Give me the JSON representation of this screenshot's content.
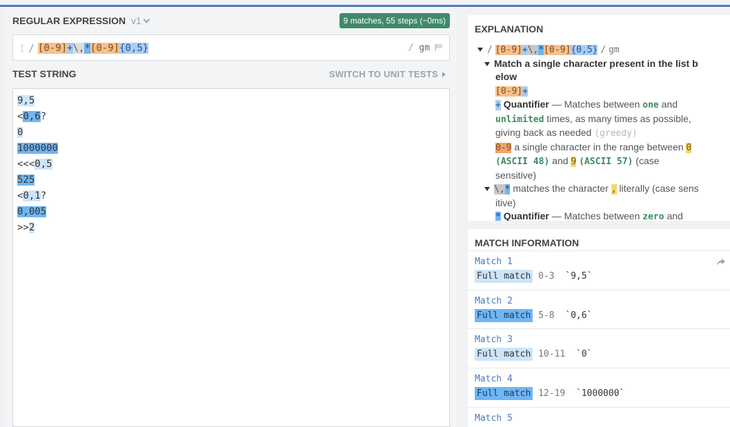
{
  "regex": {
    "header": "REGULAR EXPRESSION",
    "version": "v1",
    "status": "9 matches, 55 steps (~0ms)",
    "delimiter_open": "/",
    "tokens": [
      "[0-9]",
      "+",
      "\\,",
      "*",
      "[0-9]",
      "{0,5}"
    ],
    "delimiter_close": "/",
    "flags": "gm"
  },
  "test_string": {
    "header": "TEST STRING",
    "switch_label": "SWITCH TO UNIT TESTS",
    "lines": [
      {
        "pre": "",
        "match": "9,5",
        "post": "",
        "style": "light"
      },
      {
        "pre": "<",
        "match": "0,6",
        "post": "?",
        "style": "dark"
      },
      {
        "pre": "",
        "match": "0",
        "post": "",
        "style": "light"
      },
      {
        "pre": "",
        "match": "1000000",
        "post": "",
        "style": "dark"
      },
      {
        "pre": "<<<",
        "match": "0,5",
        "post": "",
        "style": "light"
      },
      {
        "pre": "",
        "match": "525",
        "post": "",
        "style": "dark"
      },
      {
        "pre": "<",
        "match": "0,1",
        "post": "?",
        "style": "light"
      },
      {
        "pre": "",
        "match": "0,005",
        "post": "",
        "style": "dark"
      },
      {
        "pre": ">>",
        "match": "2",
        "post": "",
        "style": "light"
      }
    ]
  },
  "explanation": {
    "header": "EXPLANATION",
    "root_open": "/",
    "root_close": "/",
    "root_flags": "gm",
    "item1_title_a": "Match a single character present in the list b",
    "item1_title_b": "elow",
    "item1_token": "[0-9]",
    "item1_plus": "+",
    "q_plus": "+",
    "quantifier": "Quantifier",
    "dash_matches_between": " — Matches between ",
    "one": "one",
    "and": " and",
    "unlimited": "unlimited",
    "times_possible": " times, as many times as possible,",
    "giving_back": "giving back as needed ",
    "greedy": "(greedy)",
    "range_chip": "0-9",
    "range_text": " a single character in the range between ",
    "zero_chip": "0",
    "ascii48": "(ASCII 48)",
    "and2": " and ",
    "nine_chip": "9",
    "ascii57": "(ASCII 57)",
    "case": " (case",
    "sensitive": "sensitive)",
    "esc_chip": "\\,",
    "star_chip": "*",
    "matches_char": " matches the character ",
    "comma_chip": ",",
    "literally_a": " literally (case sens",
    "literally_b": "itive)",
    "star2": "*",
    "quantifier2": "Quantifier",
    "matches_between2": " — Matches between ",
    "zero": "zero",
    "and3": " and"
  },
  "match_info": {
    "header": "MATCH INFORMATION",
    "matches": [
      {
        "title": "Match 1",
        "label": "Full match",
        "range": "0-3",
        "value": "`9,5`",
        "style": "light"
      },
      {
        "title": "Match 2",
        "label": "Full match",
        "range": "5-8",
        "value": "`0,6`",
        "style": "dark"
      },
      {
        "title": "Match 3",
        "label": "Full match",
        "range": "10-11",
        "value": "`0`",
        "style": "light"
      },
      {
        "title": "Match 4",
        "label": "Full match",
        "range": "12-19",
        "value": "`1000000`",
        "style": "dark"
      },
      {
        "title": "Match 5",
        "label": "",
        "range": "",
        "value": "",
        "style": "light"
      }
    ]
  },
  "colors": {
    "accent": "#4a7ab8",
    "badge": "#3f8a6b",
    "match_light": "#cde4fa",
    "match_dark": "#6fb6f4",
    "token_set": "#f6c08b"
  },
  "icons": [
    "chevron-down-icon",
    "drag-handle-icon",
    "flag-icon",
    "triangle-right-icon",
    "triangle-down-icon",
    "share-icon"
  ]
}
